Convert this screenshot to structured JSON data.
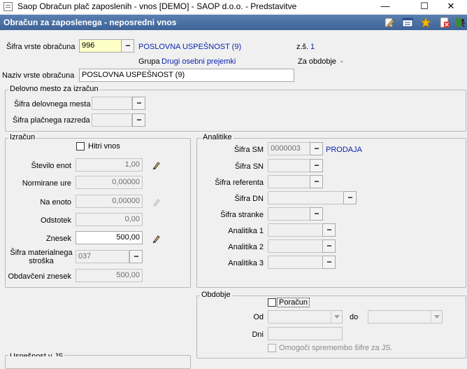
{
  "window": {
    "title": "Saop Obračun plač zaposlenih - vnos [DEMO] - SAOP d.o.o. - Predstavitve",
    "min_glyph": "—",
    "max_glyph": "☐",
    "close_glyph": "✕"
  },
  "header": {
    "title": "Obračun za zaposlenega - neposredni vnos",
    "accent": "#4a70a6"
  },
  "top": {
    "sifra_label": "Šifra vrste obračuna",
    "sifra_value": "996",
    "sifra_desc": "POSLOVNA USPEŠNOST (9)",
    "zs_label": "z.š.",
    "zs_value": "1",
    "grupa_label": "Grupa",
    "grupa_value": "Drugi osebni prejemki",
    "za_obdobje_label": "Za obdobje",
    "za_obdobje_value": "-",
    "naziv_label": "Naziv vrste obračuna",
    "naziv_value": "POSLOVNA USPEŠNOST (9)"
  },
  "delovno": {
    "title": "Delovno mesto za izračun",
    "sifra_dm_label": "Šifra delovnega mesta",
    "sifra_dm_value": "",
    "sifra_pr_label": "Šifra plačnega razreda",
    "sifra_pr_value": ""
  },
  "izracun": {
    "title": "Izračun",
    "hitri_label": "Hitri vnos",
    "stevilo_label": "Število enot",
    "stevilo_value": "1,00",
    "normirane_label": "Normirane ure",
    "normirane_value": "0,00000",
    "na_enoto_label": "Na enoto",
    "na_enoto_value": "0,00000",
    "odstotek_label": "Odstotek",
    "odstotek_value": "0,00",
    "znesek_label": "Znesek",
    "znesek_value": "500,00",
    "mat_label_1": "Šifra materialnega",
    "mat_label_2": "stroška",
    "mat_value": "037",
    "obdavceni_label": "Obdavčeni znesek",
    "obdavceni_value": "500,00"
  },
  "analitike": {
    "title": "Analitike",
    "sm_label": "Šifra SM",
    "sm_value": "0000003",
    "sm_desc": "PRODAJA",
    "sn_label": "Šifra SN",
    "ref_label": "Šifra referenta",
    "dn_label": "Šifra DN",
    "stranke_label": "Šifra stranke",
    "a1_label": "Analitika 1",
    "a2_label": "Analitika 2",
    "a3_label": "Analitika 3"
  },
  "obdobje": {
    "title": "Obdobje",
    "poracun_label": "Poračun",
    "od_label": "Od",
    "do_label": "do",
    "dni_label": "Dni",
    "omogoci_label": "Omogoči spremembo šifre za JS."
  },
  "bottom": {
    "partial_title": "Uspešnost v JS"
  },
  "icons": [
    "edit-icon",
    "calendar-list-icon",
    "star-icon",
    "delete-icon",
    "exit-icon"
  ],
  "dots": "..."
}
